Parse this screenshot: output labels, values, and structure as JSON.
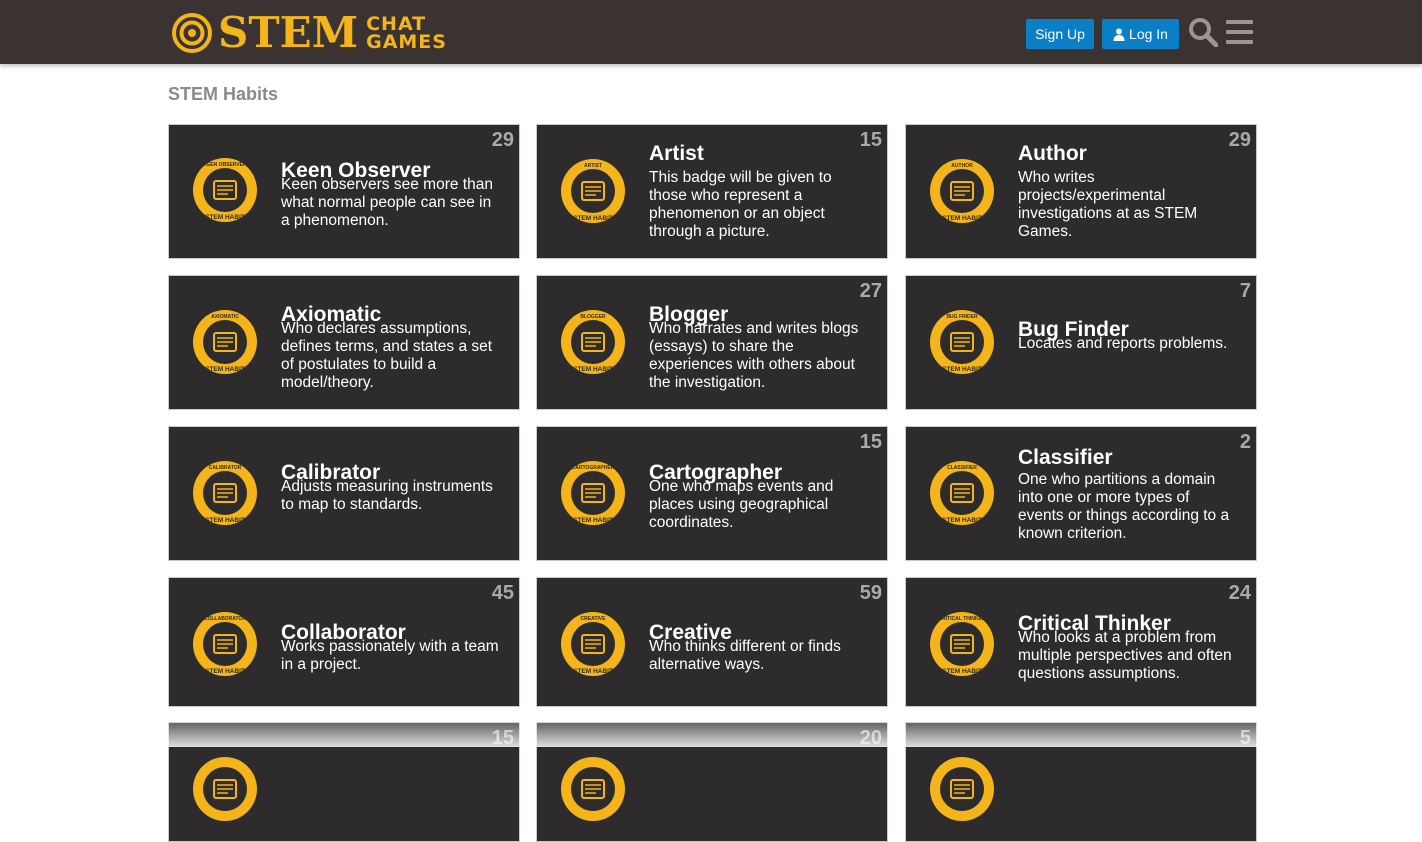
{
  "header": {
    "logo_main": "STEM",
    "logo_sub_1": "CHAT",
    "logo_sub_2": "GAMES",
    "signup_label": "Sign Up",
    "login_label": "Log In",
    "accent_color": "#f3b519",
    "button_color": "#0a7fc6",
    "icons": [
      "target-logo-icon",
      "user-icon",
      "search-icon",
      "hamburger-menu-icon"
    ]
  },
  "page": {
    "section_title": "STEM Habits"
  },
  "badges": [
    {
      "title": "Keen Observer",
      "count": "29",
      "ring_text": "KEEN OBSERVER",
      "footer_text": "STEM HABIT",
      "icon": "newspaper-icon",
      "description": "Keen observers see more than what normal people can see in a phenomenon."
    },
    {
      "title": "Artist",
      "count": "15",
      "ring_text": "ARTIST",
      "footer_text": "STEM HABIT",
      "icon": "paintbrush-icon",
      "description": "This badge will be given to those who represent a phenomenon or an object through a picture."
    },
    {
      "title": "Author",
      "count": "29",
      "ring_text": "AUTHOR",
      "footer_text": "STEM HABIT",
      "icon": "typewriter-icon",
      "description": "Who writes projects/experimental investigations at as STEM Games."
    },
    {
      "title": "Axiomatic",
      "count": "",
      "ring_text": "AXIOMATIC",
      "footer_text": "STEM HABIT",
      "icon": "crystal-icon",
      "description": "Who declares assumptions, defines terms, and states a set of postulates to build a model/theory."
    },
    {
      "title": "Blogger",
      "count": "27",
      "ring_text": "BLOGGER",
      "footer_text": "STEM HABIT",
      "icon": "monitor-icon",
      "description": "Who narrates and writes blogs (essays) to share the experiences with others about the investigation."
    },
    {
      "title": "Bug Finder",
      "count": "7",
      "ring_text": "BUG FINDER",
      "footer_text": "STEM HABIT",
      "icon": "warning-icon",
      "description": "Locates and reports problems."
    },
    {
      "title": "Calibrator",
      "count": "",
      "ring_text": "CALIBRATOR",
      "footer_text": "STEM HABIT",
      "icon": "instrument-icon",
      "description": "Adjusts measuring instruments to map to standards."
    },
    {
      "title": "Cartographer",
      "count": "15",
      "ring_text": "CARTOGRAPHER",
      "footer_text": "STEM HABIT",
      "icon": "globe-icon",
      "description": "One who maps events and places using geographical coordinates."
    },
    {
      "title": "Classifier",
      "count": "2",
      "ring_text": "CLASSIFIER",
      "footer_text": "STEM HABIT",
      "icon": "stacked-pages-icon",
      "description": "One who partitions a domain into one or more types of events or things according to a known criterion."
    },
    {
      "title": "Collaborator",
      "count": "45",
      "ring_text": "COLLABORATOR",
      "footer_text": "STEM HABIT",
      "icon": "team-icon",
      "description": "Works passionately with a team in a project."
    },
    {
      "title": "Creative",
      "count": "59",
      "ring_text": "CREATIVE",
      "footer_text": "STEM HABIT",
      "icon": "lightbulb-icon",
      "description": "Who thinks different or finds alternative ways."
    },
    {
      "title": "Critical Thinker",
      "count": "24",
      "ring_text": "CRITICAL THINKER",
      "footer_text": "STEM HABIT",
      "icon": "head-gear-icon",
      "description": "Who looks at a problem from multiple perspectives and often questions assumptions."
    },
    {
      "title": "",
      "count": "15",
      "ring_text": "",
      "footer_text": "",
      "icon": "badge-icon",
      "description": ""
    },
    {
      "title": "",
      "count": "20",
      "ring_text": "",
      "footer_text": "",
      "icon": "badge-icon",
      "description": ""
    },
    {
      "title": "",
      "count": "5",
      "ring_text": "",
      "footer_text": "",
      "icon": "badge-icon",
      "description": ""
    }
  ]
}
